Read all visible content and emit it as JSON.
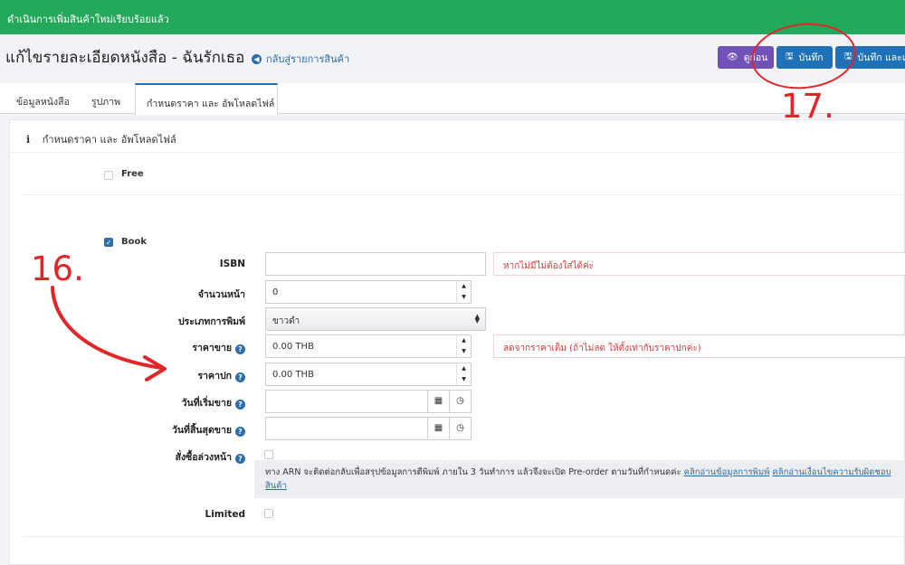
{
  "alert": {
    "text": "ดำเนินการเพิ่มสินค้าใหม่เรียบร้อยแล้ว"
  },
  "header": {
    "title": "แก้ไขรายละเอียดหนังสือ - ฉันรักเธอ",
    "back_link": "กลับสู่รายการสินค้า",
    "preview_label": "ดูก่อน",
    "save_label": "บันทึก",
    "save_more_label": "บันทึก และแ"
  },
  "tabs": [
    {
      "label": "ข้อมูลหนังสือ"
    },
    {
      "label": "รูปภาพ"
    },
    {
      "label": "กำหนดราคา และ อัพโหลดไฟล์"
    }
  ],
  "panel": {
    "heading": "กำหนดราคา และ อัพโหลดไฟล์"
  },
  "options": {
    "free_label": "Free",
    "book_label": "Book",
    "limited_label": "Limited"
  },
  "form": {
    "isbn_label": "ISBN",
    "isbn_value": "",
    "isbn_hint": "หากไม่มีไม่ต้องใส่ได้ค่ะ",
    "pages_label": "จำนวนหน้า",
    "pages_value": "0",
    "print_type_label": "ประเภทการพิมพ์",
    "print_type_value": "ขาวดำ",
    "sale_price_label": "ราคาขาย",
    "sale_price_value": "0.00 THB",
    "sale_price_hint": "ลดจากราคาเต็ม (ถ้าไม่ลด ให้ตั้งเท่ากับราคาปกค่ะ)",
    "cover_price_label": "ราคาปก",
    "cover_price_value": "0.00 THB",
    "start_date_label": "วันที่เริ่มขาย",
    "end_date_label": "วันที่สิ้นสุดขาย",
    "preorder_label": "สั่งซื้อล่วงหน้า",
    "preorder_note": "ทาง ARN จะติดต่อกลับเพื่อสรุปข้อมูลการตีพิมพ์ ภายใน 3 วันทำการ แล้วจึงจะเปิด Pre-order ตามวันที่กำหนดค่ะ",
    "preorder_link1": "คลิกอ่านข้อมูลการพิมพ์",
    "preorder_link2": "คลิกอ่านเงื่อนไขความรับผิดชอบ",
    "preorder_link2_tail": "สินค้า"
  },
  "annotations": {
    "step16": "16.",
    "step17": "17."
  },
  "colors": {
    "alert": "#24a85c",
    "primary": "#1f72b8",
    "preview": "#7152b8",
    "annotation": "#e0262a"
  }
}
